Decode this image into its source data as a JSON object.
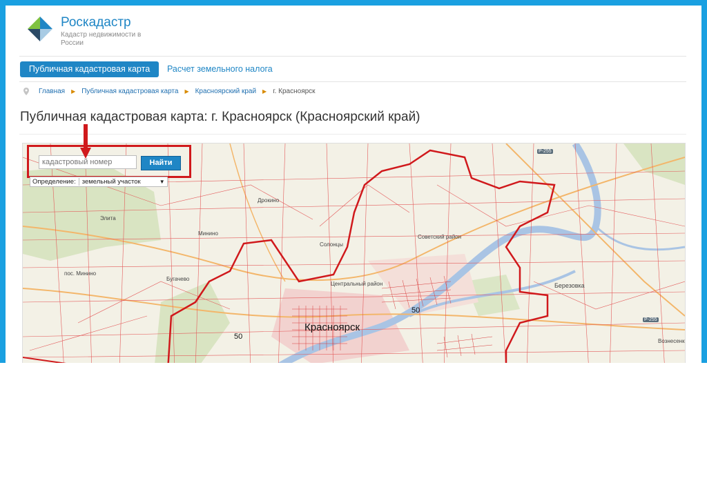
{
  "header": {
    "brand": "Роскадастр",
    "tagline": "Кадастр недвижимости в России"
  },
  "tabs": [
    {
      "label": "Публичная кадастровая карта",
      "active": true
    },
    {
      "label": "Расчет земельного налога",
      "active": false
    }
  ],
  "breadcrumb": [
    "Главная",
    "Публичная кадастровая карта",
    "Красноярский край",
    "г. Красноярск"
  ],
  "page_title": "Публичная кадастровая карта: г. Красноярск (Красноярский край)",
  "search": {
    "placeholder": "кадастровый номер",
    "button": "Найти"
  },
  "definition": {
    "label": "Определение:",
    "value": "земельный участок"
  },
  "map_labels": {
    "city": "Красноярск",
    "places": [
      "Элита",
      "Минино",
      "пос. Минино",
      "Дрокино",
      "Солонцы",
      "Бугачево",
      "Березовка",
      "Советский район",
      "Центральный район",
      "Вознесенка"
    ],
    "numbers": [
      "50",
      "50"
    ],
    "roads": [
      "Р-255",
      "Р-255"
    ]
  },
  "colors": {
    "accent": "#1f86c5",
    "frame": "#1aa0e1",
    "highlight": "#d0191c"
  }
}
